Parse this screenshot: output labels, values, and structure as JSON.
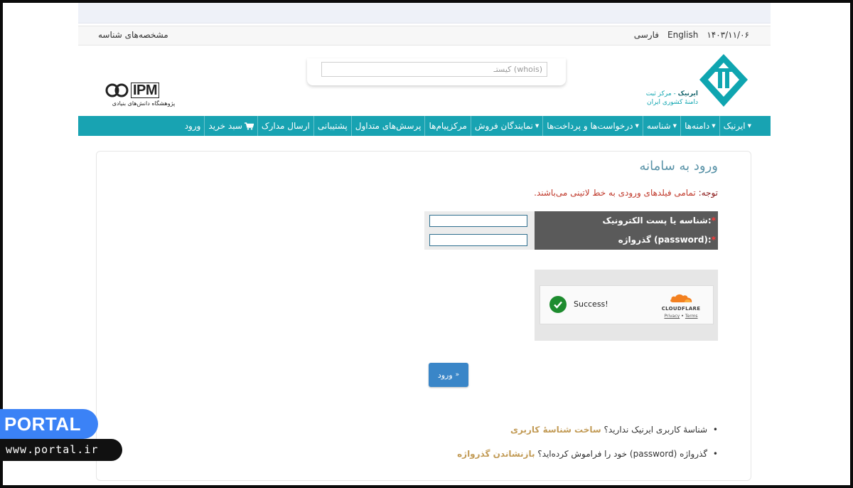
{
  "utility": {
    "left_link": "مشخصه‌های شناسه",
    "date": "۱۴۰۳/۱۱/۰۶",
    "lang_english": "English",
    "lang_farsi": "فارسی"
  },
  "search": {
    "placeholder": "کیستـ (whois)"
  },
  "ipm_logo": {
    "text": "IPM",
    "subtitle": "پژوهشگاه دانش‌های بنیادی"
  },
  "irnic_logo": {
    "line1_bold": "ایرنیک",
    "line1_rest": " - مرکز ثبت",
    "line2": "دامنهٔ کشوری ایران"
  },
  "nav": {
    "items": [
      {
        "label": "ایرنیک",
        "caret": true
      },
      {
        "label": "دامنه‌ها",
        "caret": true
      },
      {
        "label": "شناسه",
        "caret": true
      },
      {
        "label": "درخواست‌ها و پرداخت‌ها",
        "caret": true
      },
      {
        "label": "نمایندگان فروش",
        "caret": true
      },
      {
        "label": "مرکزپیام‌ها",
        "caret": false
      },
      {
        "label": "پرسش‌های متداول",
        "caret": false
      },
      {
        "label": "پشتیبانی",
        "caret": false
      },
      {
        "label": "ارسال مدارک",
        "caret": false
      },
      {
        "label": "سبد خرید",
        "caret": false,
        "icon": "cart-icon"
      },
      {
        "label": "ورود",
        "caret": false
      }
    ]
  },
  "page": {
    "title": "ورود به سامانه",
    "notice_prefix": "توجه:",
    "notice": " تمامی فیلدهای ورودی به خط لاتینی می‌باشند."
  },
  "form": {
    "username_label": "شناسه یا پست الکترونیک:",
    "password_label": "گذرواژه (password):",
    "required_mark": "*",
    "username_value": "",
    "password_value": ""
  },
  "captcha": {
    "status": "Success!",
    "brand": "CLOUDFLARE",
    "privacy": "Privacy",
    "separator": "•",
    "terms": "Terms"
  },
  "login_button": {
    "label": "ورود",
    "icon": "chevron-icon"
  },
  "help_links": [
    {
      "text": "شناسهٔ کاربری ایرنیک ندارید؟ ",
      "link": "ساخت شناسهٔ کاربری"
    },
    {
      "text": "گذرواژه (password) خود را فراموش کرده‌اید؟ ",
      "link": "بازنشاندن گذرواژه"
    }
  ],
  "watermark": {
    "brand": "PORTAL",
    "url": "www.portal.ir"
  },
  "colors": {
    "nav": "#18a3b2",
    "title": "#5a93a8",
    "notice": "#c0392b",
    "link": "#c29b56",
    "button": "#3a86c8",
    "success": "#1e8c2f"
  }
}
